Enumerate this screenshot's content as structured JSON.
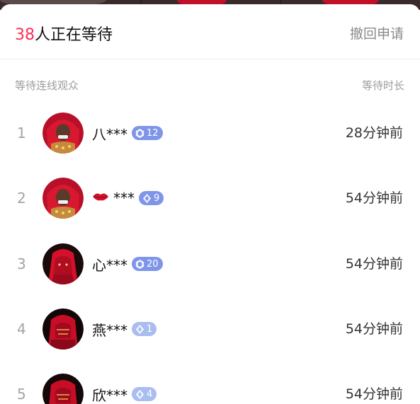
{
  "header": {
    "count": "38",
    "count_suffix": "人正在等待",
    "withdraw_label": "撤回申请"
  },
  "columns": {
    "left": "等待连线观众",
    "right": "等待时长"
  },
  "queue": [
    {
      "rank": "1",
      "name": "八***",
      "has_lips": false,
      "level": "12",
      "badge_style": "strong",
      "time": "28分钟前"
    },
    {
      "rank": "2",
      "name": "***",
      "has_lips": true,
      "level": "9",
      "badge_style": "strong",
      "time": "54分钟前"
    },
    {
      "rank": "3",
      "name": "心***",
      "level": "20",
      "badge_style": "strong",
      "time": "54分钟前"
    },
    {
      "rank": "4",
      "name": "燕***",
      "level": "1",
      "badge_style": "light",
      "time": "54分钟前"
    },
    {
      "rank": "5",
      "name": "欣***",
      "level": "4",
      "badge_style": "light",
      "time": "54分钟前"
    }
  ],
  "colors": {
    "accent_count": "#ff2d55",
    "badge_strong": "#7f95e8",
    "badge_light": "#a9bdf0"
  }
}
